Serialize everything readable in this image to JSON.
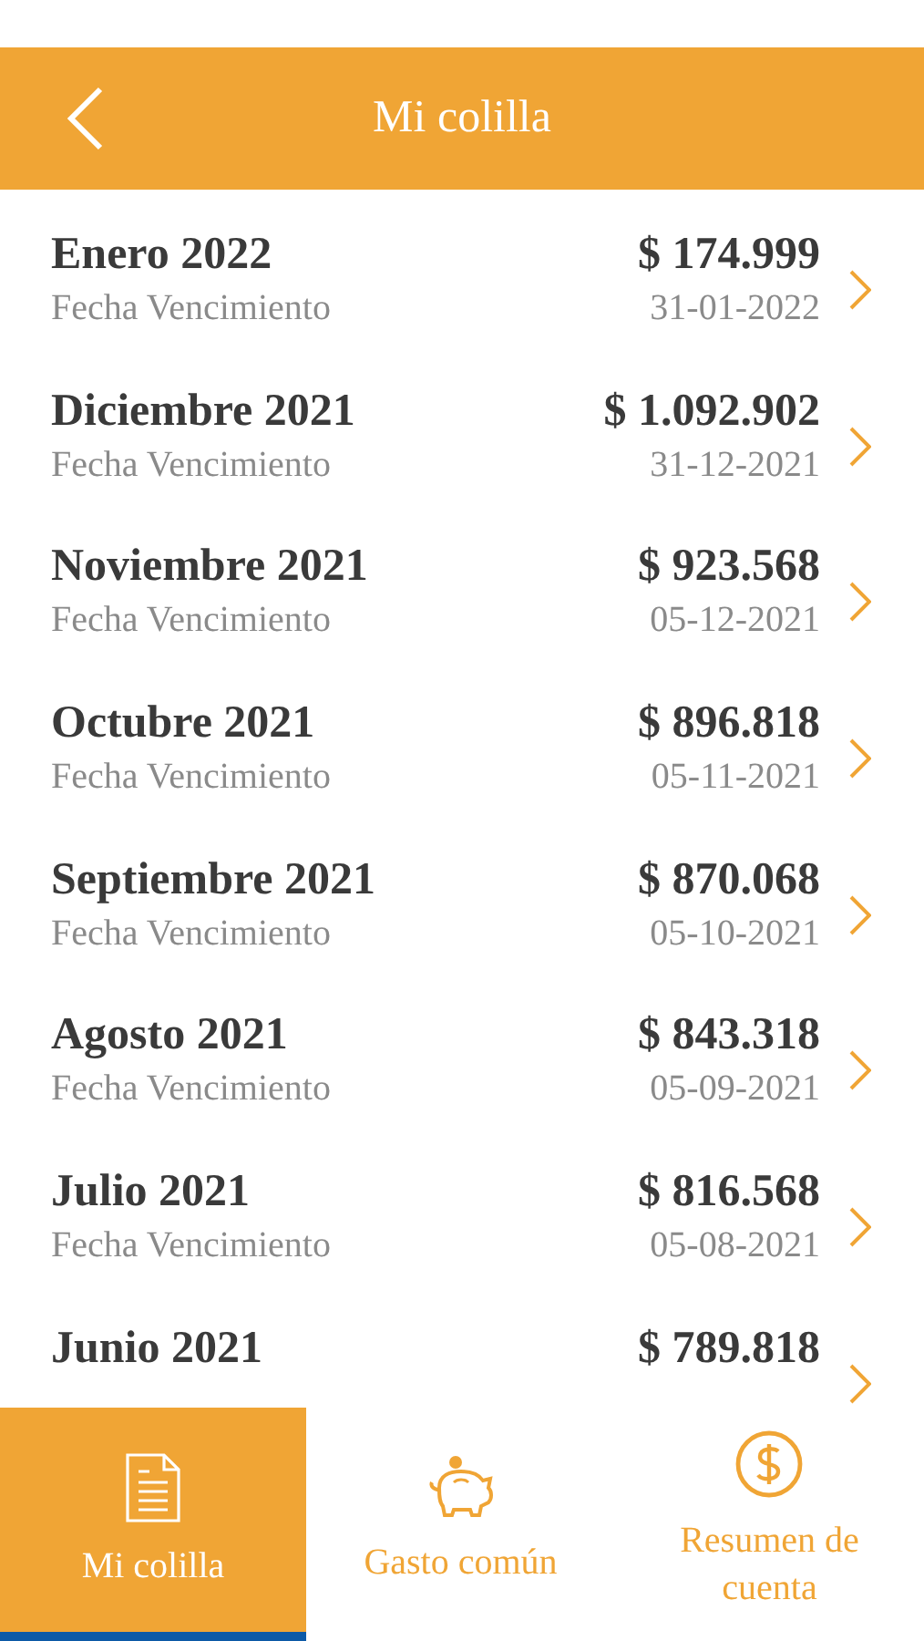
{
  "header": {
    "title": "Mi colilla"
  },
  "items": [
    {
      "month": "Enero 2022",
      "label": "Fecha Vencimiento",
      "amount": "$ 174.999",
      "date": "31-01-2022"
    },
    {
      "month": "Diciembre 2021",
      "label": "Fecha Vencimiento",
      "amount": "$ 1.092.902",
      "date": "31-12-2021"
    },
    {
      "month": "Noviembre 2021",
      "label": "Fecha Vencimiento",
      "amount": "$ 923.568",
      "date": "05-12-2021"
    },
    {
      "month": "Octubre 2021",
      "label": "Fecha Vencimiento",
      "amount": "$ 896.818",
      "date": "05-11-2021"
    },
    {
      "month": "Septiembre 2021",
      "label": "Fecha Vencimiento",
      "amount": "$ 870.068",
      "date": "05-10-2021"
    },
    {
      "month": "Agosto 2021",
      "label": "Fecha Vencimiento",
      "amount": "$ 843.318",
      "date": "05-09-2021"
    },
    {
      "month": "Julio 2021",
      "label": "Fecha Vencimiento",
      "amount": "$ 816.568",
      "date": "05-08-2021"
    },
    {
      "month": "Junio 2021",
      "amount": "$ 789.818"
    }
  ],
  "tabs": [
    {
      "kind": "document",
      "label": "Mi colilla",
      "selected": true
    },
    {
      "kind": "piggy",
      "label": "Gasto común",
      "selected": false
    },
    {
      "kind": "dollar",
      "label": "Resumen de cuenta",
      "selected": false
    }
  ]
}
